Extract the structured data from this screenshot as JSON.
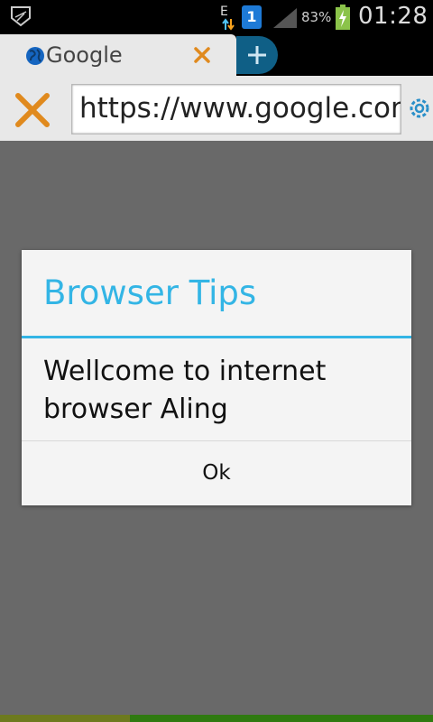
{
  "status_bar": {
    "network_type": "E",
    "notification_badge": "1",
    "battery_percent": "83%",
    "time": "01:28",
    "icons": [
      "app-notification-icon",
      "data-arrows-icon",
      "notification-1-icon",
      "signal-icon",
      "battery-charging-icon"
    ]
  },
  "tabs": [
    {
      "title": "Google",
      "icon": "globe-icon"
    }
  ],
  "address_bar": {
    "url": "https://www.google.com"
  },
  "dialog": {
    "title": "Browser Tips",
    "message": "Wellcome to internet browser Aling",
    "ok_label": "Ok"
  },
  "colors": {
    "accent": "#33b5e5",
    "close_orange": "#e08a1e",
    "dim_background": "#696969"
  }
}
